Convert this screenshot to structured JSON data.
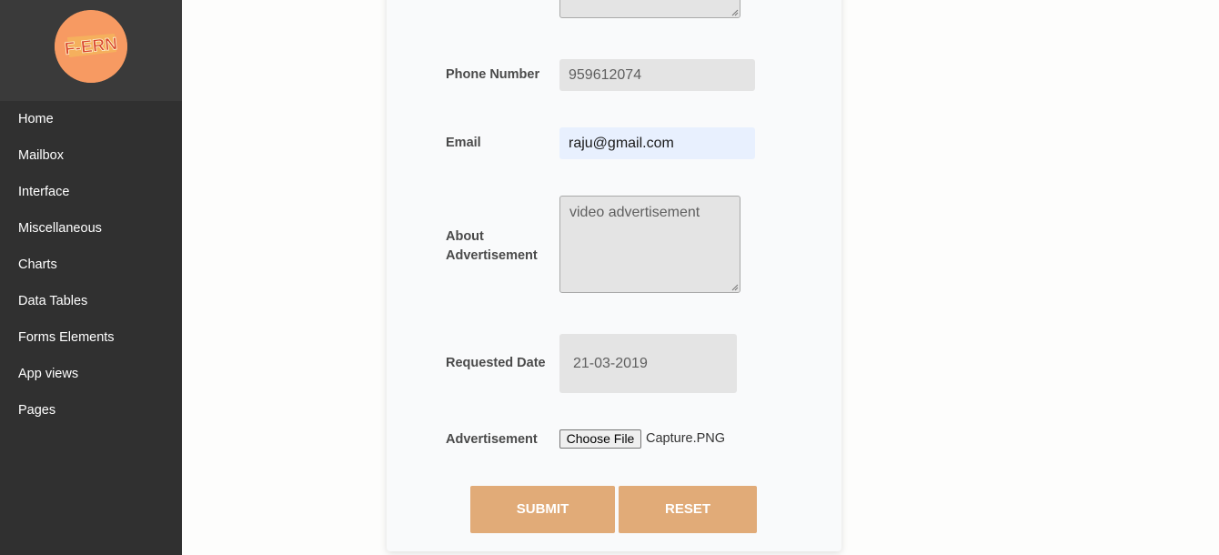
{
  "logo": {
    "text": "F-ERN",
    "bg_color": "#f79a62"
  },
  "sidebar": {
    "items": [
      {
        "label": "Home"
      },
      {
        "label": "Mailbox"
      },
      {
        "label": "Interface"
      },
      {
        "label": "Miscellaneous"
      },
      {
        "label": "Charts"
      },
      {
        "label": "Data Tables"
      },
      {
        "label": "Forms Elements"
      },
      {
        "label": "App views"
      },
      {
        "label": "Pages"
      }
    ]
  },
  "form": {
    "phone": {
      "label": "Phone Number",
      "value": "959612074"
    },
    "email": {
      "label": "Email",
      "value": "raju@gmail.com"
    },
    "about": {
      "label_line1": "About",
      "label_line2": "Advertisement",
      "value": "video advertisement"
    },
    "date": {
      "label": "Requested Date",
      "value": "21-03-2019"
    },
    "advertisement": {
      "label": "Advertisement",
      "button_label": "Choose File",
      "file_name": "Capture.PNG"
    },
    "submit_label": "SUBMIT",
    "reset_label": "RESET"
  },
  "colors": {
    "sidebar_bg": "#303030",
    "accent_button": "#e1ab78",
    "active_input": "#e8f0fe"
  }
}
